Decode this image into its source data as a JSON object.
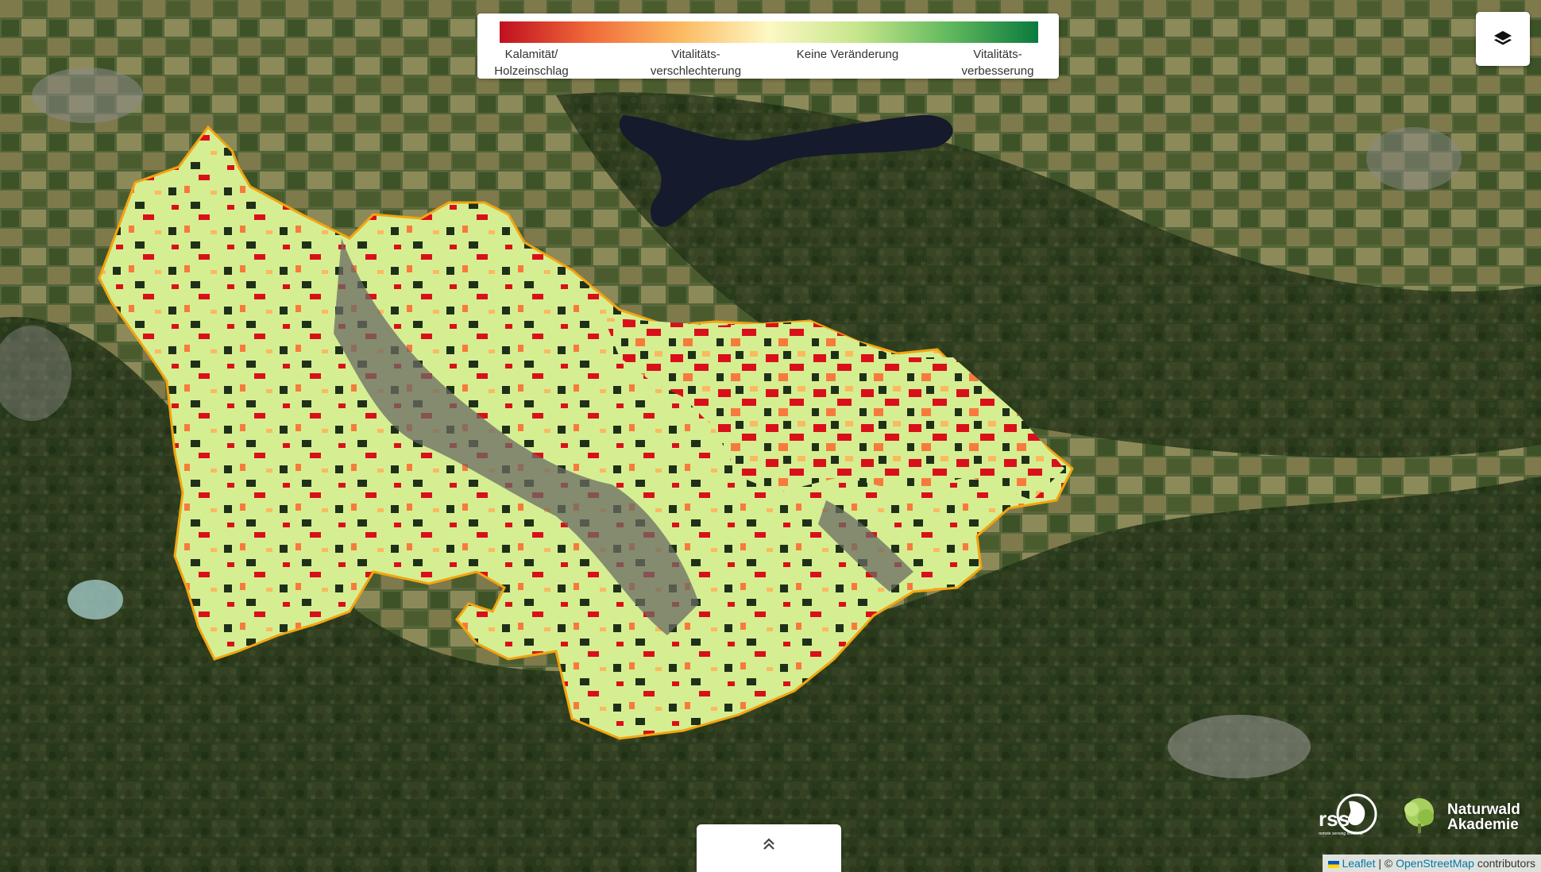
{
  "legend": {
    "gradient_colors": [
      "#c0101f",
      "#f06a3a",
      "#fbb960",
      "#fdf8c4",
      "#c6e58a",
      "#62b95e",
      "#0a7a3e"
    ],
    "labels": [
      {
        "line1": "Kalamität/",
        "line2": "Holzeinschlag"
      },
      {
        "line1": "Vitalitäts-",
        "line2": "verschlechterung"
      },
      {
        "line1": "Keine Veränderung",
        "line2": ""
      },
      {
        "line1": "Vitalitäts-",
        "line2": "verbesserung"
      }
    ]
  },
  "layer_control": {
    "icon": "layers-icon"
  },
  "panel_toggle": {
    "icon": "chevron-double-up-icon"
  },
  "logos": {
    "rss": {
      "text": "rss",
      "subtext": "remote sensing solutions"
    },
    "naturwald": {
      "line1": "Naturwald",
      "line2": "Akademie"
    }
  },
  "attribution": {
    "leaflet": "Leaflet",
    "separator": " | © ",
    "osm": "OpenStreetMap",
    "suffix": " contributors"
  },
  "colors": {
    "boundary": "#f3a50f",
    "forest_stable": "#d4ef8f",
    "calamity": "#d9101a",
    "deterioration": "#f77a3c",
    "satellite_base": "#2f3d22"
  }
}
